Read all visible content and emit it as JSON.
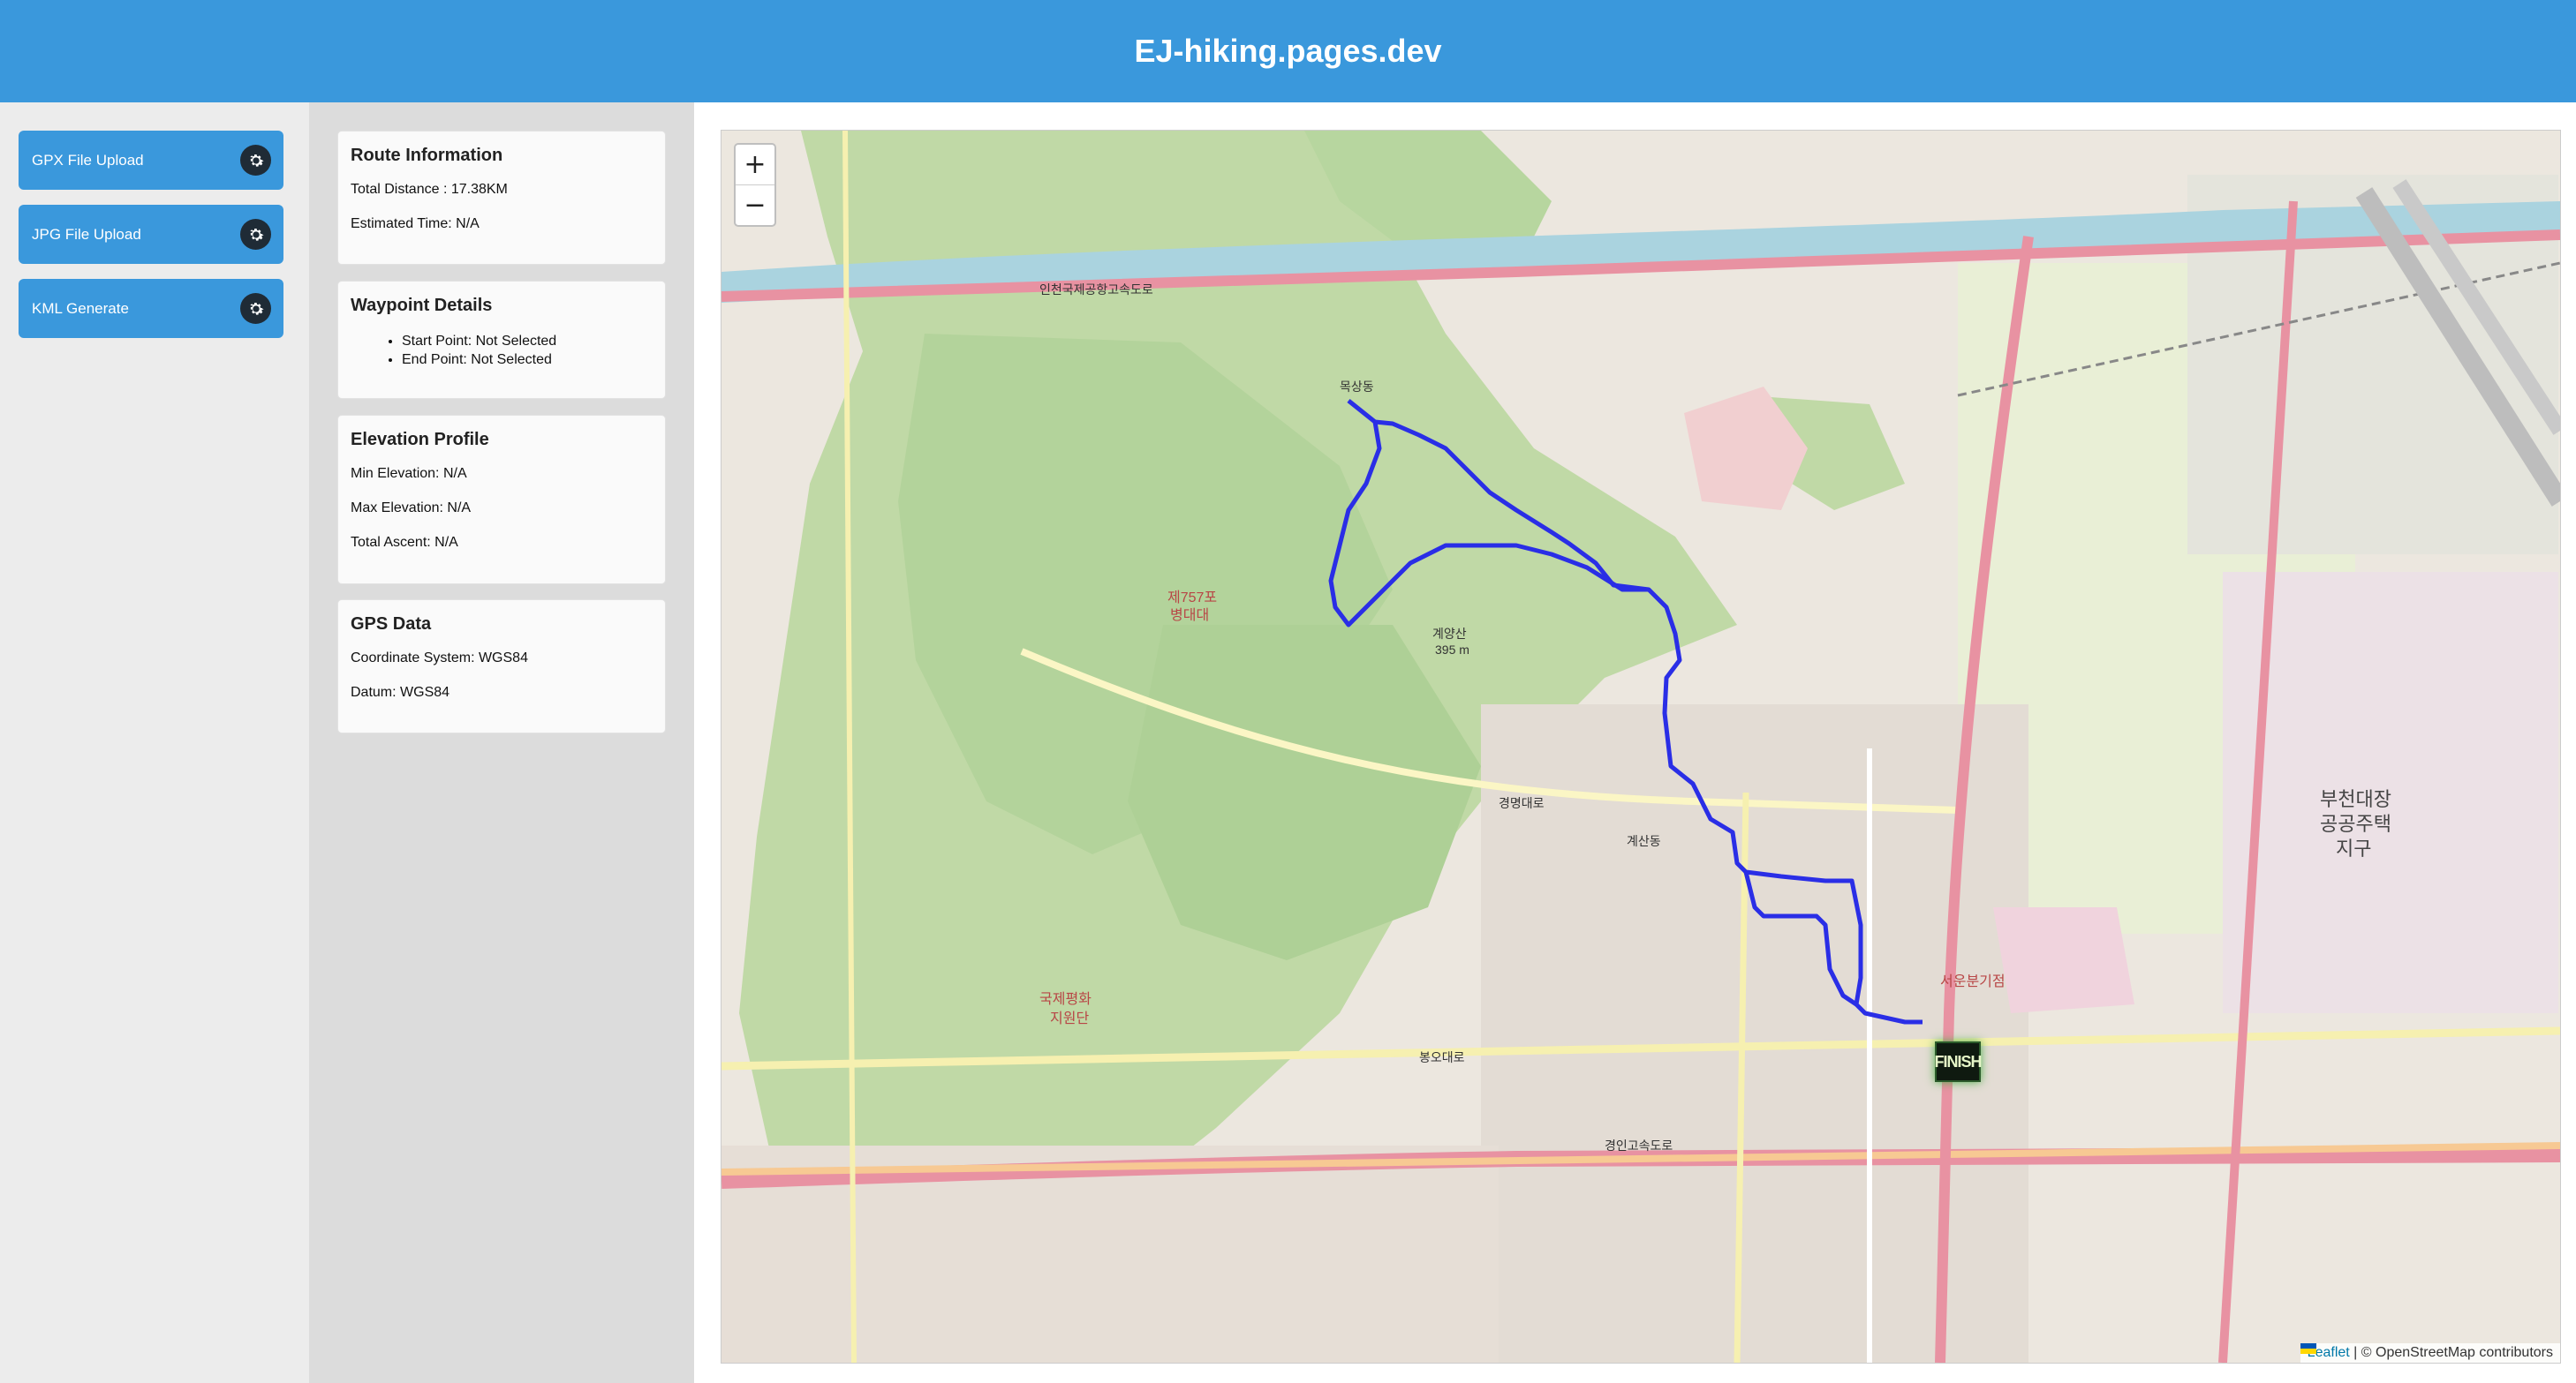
{
  "app": {
    "title": "EJ-hiking.pages.dev"
  },
  "sidebar": {
    "buttons": [
      {
        "label": "GPX File Upload",
        "icon": "gear-icon"
      },
      {
        "label": "JPG File Upload",
        "icon": "gear-icon"
      },
      {
        "label": "KML Generate",
        "icon": "gear-icon"
      }
    ]
  },
  "route_info": {
    "title": "Route Information",
    "total_distance": "Total Distance : 17.38KM",
    "estimated_time": "Estimated Time: N/A"
  },
  "waypoints": {
    "title": "Waypoint Details",
    "start": "Start Point: Not Selected",
    "end": "End Point: Not Selected"
  },
  "elevation": {
    "title": "Elevation Profile",
    "min": "Min Elevation: N/A",
    "max": "Max Elevation: N/A",
    "ascent": "Total Ascent: N/A"
  },
  "gps": {
    "title": "GPS Data",
    "coord_system": "Coordinate System: WGS84",
    "datum": "Datum: WGS84"
  },
  "map": {
    "zoom_in": "+",
    "zoom_out": "−",
    "attribution_leaflet": "Leaflet",
    "attribution_rest": " | © OpenStreetMap contributors",
    "finish_label": "FINISH",
    "labels": {
      "mokdong": "목상동",
      "gyeyangsan": "계양산",
      "gyeyangsan_elev": "395 m",
      "gukje": "국제평화",
      "gukje2": "지원단",
      "bucheon1": "부천대장",
      "bucheon2": "공공주택",
      "bucheon3": "지구",
      "gyesan": "계산동",
      "gyeongmyeong": "경명대로",
      "bongo": "봉오대로",
      "gyeongin": "경인고속도로",
      "incheon": "인천국제공항고속도로",
      "unit757_1": "제757포",
      "unit757_2": "병대대",
      "seoun": "서운분기점"
    }
  },
  "colors": {
    "header": "#3a98dc",
    "button": "#3a98dc",
    "track": "#2a2ee6"
  }
}
